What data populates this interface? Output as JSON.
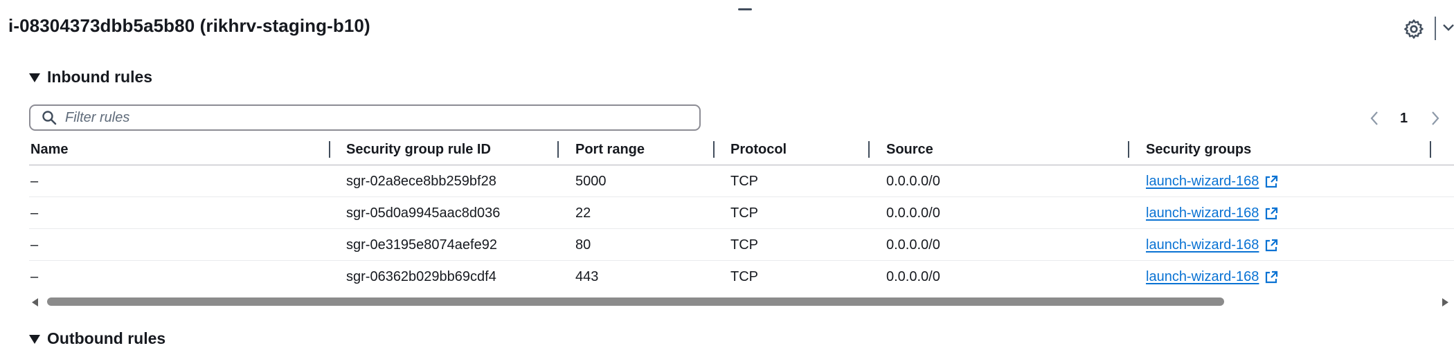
{
  "panel": {
    "title": "i-08304373dbb5a5b80 (rikhrv-staging-b10)",
    "settings_icon": "gear-icon",
    "collapse_icon": "chevron-down-icon"
  },
  "inbound": {
    "heading": "Inbound rules",
    "filter_placeholder": "Filter rules",
    "page": "1",
    "columns": [
      "Name",
      "Security group rule ID",
      "Port range",
      "Protocol",
      "Source",
      "Security groups"
    ],
    "rows": [
      {
        "name": "–",
        "rule_id": "sgr-02a8ece8bb259bf28",
        "port": "5000",
        "protocol": "TCP",
        "source": "0.0.0.0/0",
        "group": "launch-wizard-168"
      },
      {
        "name": "–",
        "rule_id": "sgr-05d0a9945aac8d036",
        "port": "22",
        "protocol": "TCP",
        "source": "0.0.0.0/0",
        "group": "launch-wizard-168"
      },
      {
        "name": "–",
        "rule_id": "sgr-0e3195e8074aefe92",
        "port": "80",
        "protocol": "TCP",
        "source": "0.0.0.0/0",
        "group": "launch-wizard-168"
      },
      {
        "name": "–",
        "rule_id": "sgr-06362b029bb69cdf4",
        "port": "443",
        "protocol": "TCP",
        "source": "0.0.0.0/0",
        "group": "launch-wizard-168"
      }
    ]
  },
  "outbound": {
    "heading": "Outbound rules"
  },
  "colors": {
    "link": "#0972d3",
    "text": "#16191f",
    "border": "#8c8c94"
  }
}
